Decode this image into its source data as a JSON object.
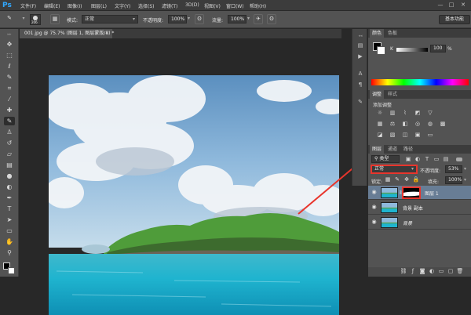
{
  "app": {
    "logo": "Ps"
  },
  "menu": [
    "文件(F)",
    "编辑(E)",
    "图像(I)",
    "图层(L)",
    "文字(Y)",
    "选择(S)",
    "滤镜(T)",
    "3D(D)",
    "视图(V)",
    "窗口(W)",
    "帮助(H)"
  ],
  "window_controls": [
    "—",
    "□",
    "✕"
  ],
  "options": {
    "brush_size": "206",
    "mode_label": "模式:",
    "mode_value": "正常",
    "opacity_label": "不透明度:",
    "opacity_value": "100%",
    "flow_label": "流量:",
    "flow_value": "100%",
    "workspace": "基本功能"
  },
  "document": {
    "tab_title": "001.jpg @ 75.7% (图层 1, 图层蒙版/8) *",
    "close": "×"
  },
  "color_panel": {
    "tabs": [
      "颜色",
      "色板"
    ],
    "channel_label": "K",
    "value": "100",
    "unit": "%"
  },
  "adjustments_panel": {
    "tabs": [
      "调整",
      "样式"
    ],
    "title": "添加调整"
  },
  "layers_panel": {
    "tabs": [
      "图层",
      "通道",
      "路径"
    ],
    "filter_kind": "类型",
    "blend_mode": "正常",
    "opacity_label": "不透明度:",
    "opacity_value": "53%",
    "lock_label": "锁定:",
    "fill_label": "填充:",
    "fill_value": "100%",
    "layers": [
      {
        "name": "图层 1",
        "selected": true
      },
      {
        "name": "背景 副本",
        "selected": false
      },
      {
        "name": "背景",
        "selected": false
      }
    ]
  },
  "colors": {
    "highlight_box": "#e8352c",
    "ps_blue": "#31a8ff",
    "selected_layer": "#687d95"
  }
}
